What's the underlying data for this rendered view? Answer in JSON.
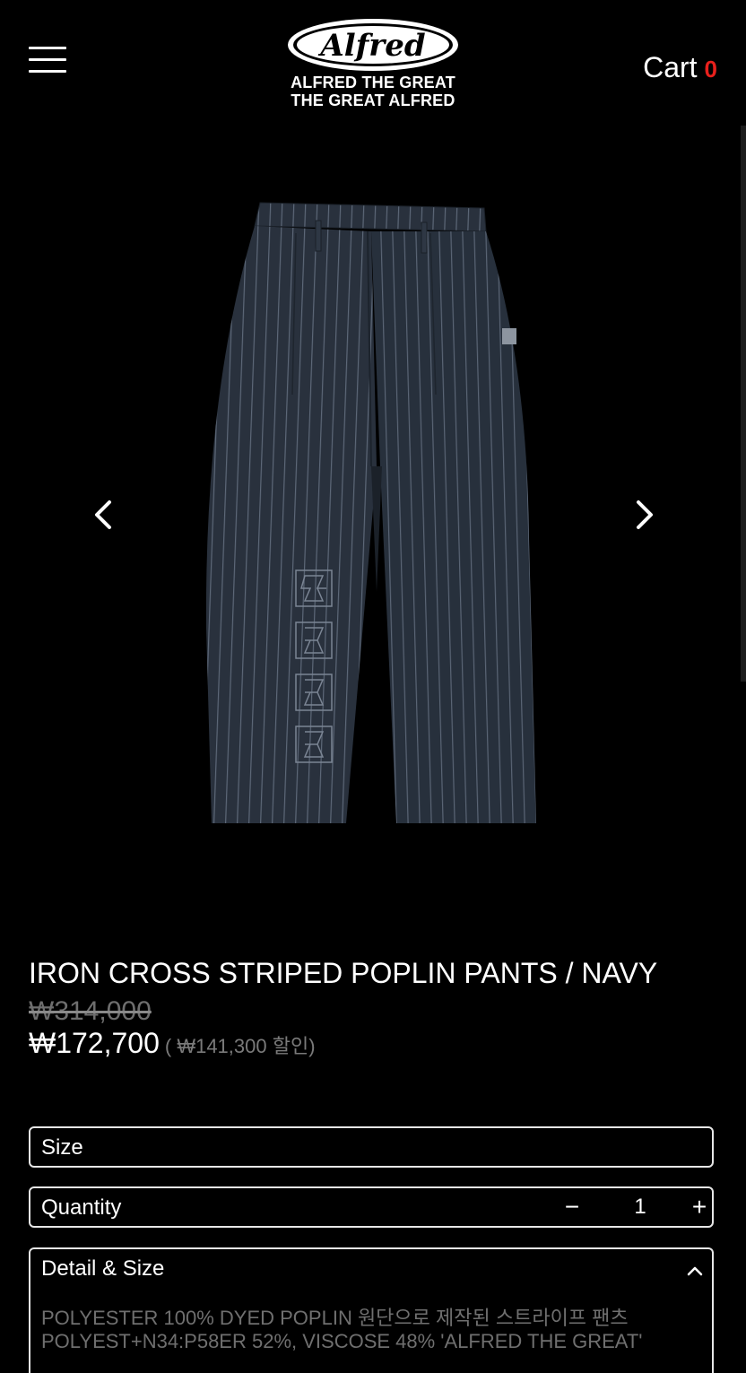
{
  "header": {
    "menu_icon": "hamburger-menu-icon",
    "logo": {
      "wordmark": "Alfred",
      "line1": "ALFRED THE GREAT",
      "line2": "THE GREAT ALFRED"
    },
    "cart_label": "Cart",
    "cart_count": "0"
  },
  "gallery": {
    "prev_icon": "chevron-left-icon",
    "next_icon": "chevron-right-icon"
  },
  "product": {
    "title": "IRON CROSS STRIPED POPLIN PANTS / NAVY",
    "original_price": "₩314,000",
    "sale_price": "₩172,700",
    "discount_text": "( ₩141,300 할인)"
  },
  "options": {
    "size_label": "Size",
    "quantity_label": "Quantity",
    "quantity_minus": "−",
    "quantity_value": "1",
    "quantity_plus": "+"
  },
  "detail": {
    "label": "Detail & Size",
    "line1": "POLYESTER 100% DYED POPLIN 원단으로 제작된 스트라이프 팬츠",
    "line2": "POLYEST+N34:P58ER 52%, VISCOSE 48% 'ALFRED THE GREAT'"
  },
  "colors": {
    "background": "#000000",
    "text": "#ffffff",
    "cart_count": "#e8201c",
    "muted": "#6e6e6e",
    "pants_navy": "#2a3340"
  }
}
